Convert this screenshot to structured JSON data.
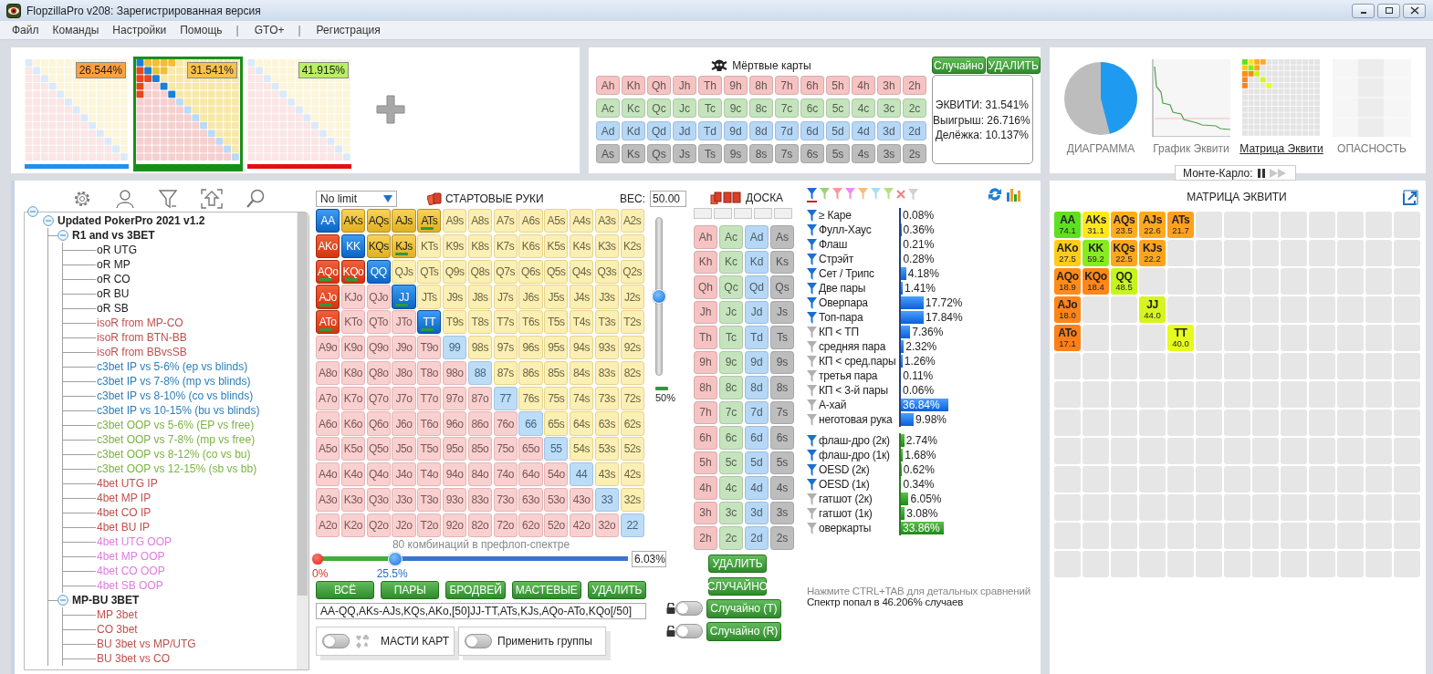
{
  "window": {
    "title": "FlopzillaPro v208: Зарегистрированная версия"
  },
  "menu": [
    {
      "label": "Файл",
      "kind": "item"
    },
    {
      "label": "Команды",
      "kind": "item"
    },
    {
      "label": "Настройки",
      "kind": "item"
    },
    {
      "label": "Помощь",
      "kind": "item"
    },
    {
      "label": "|",
      "kind": "separator"
    },
    {
      "label": "GTO+",
      "kind": "item"
    },
    {
      "label": "|",
      "kind": "separator"
    },
    {
      "label": "Регистрация",
      "kind": "item"
    }
  ],
  "ranges": [
    {
      "selected": false,
      "color": "#1e90ee",
      "equity": {
        "text": "26.544%",
        "color": "#ffa040"
      }
    },
    {
      "selected": true,
      "color": "#139013",
      "equity": {
        "text": "31.541%",
        "color": "#f8c24a"
      }
    },
    {
      "selected": false,
      "color": "#e01010",
      "equity": {
        "text": "41.915%",
        "color": "#b8f064"
      }
    }
  ],
  "dead_cards": {
    "title": "Мёртвые карты",
    "buttons": [
      "Случайно",
      "УДАЛИТЬ"
    ],
    "rows": [
      {
        "color": "#f6c3c3",
        "cards": [
          "Ah",
          "Kh",
          "Qh",
          "Jh",
          "Th",
          "9h",
          "8h",
          "7h",
          "6h",
          "5h",
          "4h",
          "3h",
          "2h"
        ]
      },
      {
        "color": "#c5e4bd",
        "cards": [
          "Ac",
          "Kc",
          "Qc",
          "Jc",
          "Tc",
          "9c",
          "8c",
          "7c",
          "6c",
          "5c",
          "4c",
          "3c",
          "2c"
        ]
      },
      {
        "color": "#b6d8f6",
        "cards": [
          "Ad",
          "Kd",
          "Qd",
          "Jd",
          "Td",
          "9d",
          "8d",
          "7d",
          "6d",
          "5d",
          "4d",
          "3d",
          "2d"
        ]
      },
      {
        "color": "#bdbdbd",
        "cards": [
          "As",
          "Ks",
          "Qs",
          "Js",
          "Ts",
          "9s",
          "8s",
          "7s",
          "6s",
          "5s",
          "4s",
          "3s",
          "2s"
        ]
      }
    ]
  },
  "equity_summary": [
    "ЭКВИТИ: 31.541%",
    "Выигрыш: 26.716%",
    "Делёжка: 10.137%"
  ],
  "chart_tabs": [
    {
      "label": "ДИАГРАММА",
      "kind": "pie",
      "selected": false
    },
    {
      "label": "График Эквити",
      "kind": "line",
      "selected": false
    },
    {
      "label": "Матрица Эквити",
      "kind": "matrix",
      "selected": true
    },
    {
      "label": "ОПАСНОСТЬ",
      "kind": "danger",
      "selected": false
    }
  ],
  "monte_carlo": {
    "label": "Монте-Карло:"
  },
  "tree": {
    "expanded": true,
    "children": [
      {
        "label": "Updated PokerPro 2021 v1.2",
        "expanded": true,
        "children": [
          {
            "label": "R1 and vs 3BET",
            "expanded": true,
            "children": [
              {
                "label": "oR UTG",
                "color": "#1a1a1a"
              },
              {
                "label": "oR MP",
                "color": "#1a1a1a"
              },
              {
                "label": "oR CO",
                "color": "#1a1a1a"
              },
              {
                "label": "oR BU",
                "color": "#1a1a1a"
              },
              {
                "label": "oR SB",
                "color": "#1a1a1a"
              },
              {
                "label": "isoR from MP-CO",
                "color": "#c0504d"
              },
              {
                "label": "isoR from BTN-BB",
                "color": "#c0504d"
              },
              {
                "label": "isoR from BBvsSB",
                "color": "#c0504d"
              },
              {
                "label": "c3bet IP vs 5-6% (ep vs blinds)",
                "color": "#2e7fb8"
              },
              {
                "label": "c3bet IP vs 7-8% (mp vs blinds)",
                "color": "#2e7fb8"
              },
              {
                "label": "c3bet IP vs 8-10% (co vs blinds)",
                "color": "#2e7fb8"
              },
              {
                "label": "c3bet IP vs 10-15% (bu vs blinds)",
                "color": "#2e7fb8"
              },
              {
                "label": "c3bet OOP vs 5-6% (EP vs free)",
                "color": "#7cb342"
              },
              {
                "label": "c3bet OOP vs 7-8% (mp vs free)",
                "color": "#7cb342"
              },
              {
                "label": "c3bet OOP vs 8-12% (co vs bu)",
                "color": "#7cb342"
              },
              {
                "label": "c3bet OOP vs 12-15% (sb vs bb)",
                "color": "#7cb342"
              },
              {
                "label": "4bet UTG IP",
                "color": "#c0504d"
              },
              {
                "label": "4bet MP IP",
                "color": "#c0504d"
              },
              {
                "label": "4bet CO IP",
                "color": "#c0504d"
              },
              {
                "label": "4bet BU IP",
                "color": "#c0504d"
              },
              {
                "label": "4bet UTG OOP",
                "color": "#e07be0"
              },
              {
                "label": "4bet MP OOP",
                "color": "#e07be0"
              },
              {
                "label": "4bet CO OOP",
                "color": "#e07be0"
              },
              {
                "label": "4bet SB OOP",
                "color": "#e07be0"
              }
            ]
          },
          {
            "label": "MP-BU 3BET",
            "expanded": true,
            "children": [
              {
                "label": "MP 3bet",
                "color": "#c0504d"
              },
              {
                "label": "CO 3bet",
                "color": "#c0504d"
              },
              {
                "label": "BU 3bet vs MP/UTG",
                "color": "#c0504d"
              },
              {
                "label": "BU 3bet vs CO",
                "color": "#c0504d"
              }
            ]
          }
        ]
      }
    ]
  },
  "hands_panel": {
    "game": "No limit",
    "title": "СТАРТОВЫЕ РУКИ",
    "weight_label": "ВЕС:",
    "weight_value": "50.00",
    "combos": "80 комбинаций в префлоп-спектре",
    "min_label": "0%",
    "slider_label": "25.5%",
    "percent": "6.03%",
    "buttons": [
      "ВСЁ",
      "ПАРЫ",
      "БРОДВЕЙ",
      "МАСТЕВЫЕ",
      "УДАЛИТЬ"
    ],
    "range_text": "AA-QQ,AKs-AJs,KQs,AKo,[50]JJ-TT,ATs,KJs,AQo-ATo,KQo[/50]",
    "toggles": [
      {
        "label": "МАСТИ КАРТ",
        "on": false,
        "kind": "suits"
      },
      {
        "label": "Применить группы",
        "on": false,
        "kind": "plain"
      }
    ]
  },
  "weight": {
    "level": 0.5,
    "reading": "50%"
  },
  "combo_slider": {
    "level": 0.255
  },
  "hands": [
    [
      {
        "label": "AA",
        "selected": true,
        "partial": false
      },
      {
        "label": "AKs",
        "selected": true,
        "partial": false
      },
      {
        "label": "AQs",
        "selected": true,
        "partial": false
      },
      {
        "label": "AJs",
        "selected": true,
        "partial": false
      },
      {
        "label": "ATs",
        "selected": true,
        "partial": true
      },
      {
        "label": "A9s",
        "selected": false,
        "partial": false
      },
      {
        "label": "A8s",
        "selected": false,
        "partial": false
      },
      {
        "label": "A7s",
        "selected": false,
        "partial": false
      },
      {
        "label": "A6s",
        "selected": false,
        "partial": false
      },
      {
        "label": "A5s",
        "selected": false,
        "partial": false
      },
      {
        "label": "A4s",
        "selected": false,
        "partial": false
      },
      {
        "label": "A3s",
        "selected": false,
        "partial": false
      },
      {
        "label": "A2s",
        "selected": false,
        "partial": false
      }
    ],
    [
      {
        "label": "AKo",
        "selected": true,
        "partial": false
      },
      {
        "label": "KK",
        "selected": true,
        "partial": false
      },
      {
        "label": "KQs",
        "selected": true,
        "partial": false
      },
      {
        "label": "KJs",
        "selected": true,
        "partial": true
      },
      {
        "label": "KTs",
        "selected": false,
        "partial": false
      },
      {
        "label": "K9s",
        "selected": false,
        "partial": false
      },
      {
        "label": "K8s",
        "selected": false,
        "partial": false
      },
      {
        "label": "K7s",
        "selected": false,
        "partial": false
      },
      {
        "label": "K6s",
        "selected": false,
        "partial": false
      },
      {
        "label": "K5s",
        "selected": false,
        "partial": false
      },
      {
        "label": "K4s",
        "selected": false,
        "partial": false
      },
      {
        "label": "K3s",
        "selected": false,
        "partial": false
      },
      {
        "label": "K2s",
        "selected": false,
        "partial": false
      }
    ],
    [
      {
        "label": "AQo",
        "selected": true,
        "partial": true
      },
      {
        "label": "KQo",
        "selected": true,
        "partial": true
      },
      {
        "label": "QQ",
        "selected": true,
        "partial": false
      },
      {
        "label": "QJs",
        "selected": false,
        "partial": false
      },
      {
        "label": "QTs",
        "selected": false,
        "partial": false
      },
      {
        "label": "Q9s",
        "selected": false,
        "partial": false
      },
      {
        "label": "Q8s",
        "selected": false,
        "partial": false
      },
      {
        "label": "Q7s",
        "selected": false,
        "partial": false
      },
      {
        "label": "Q6s",
        "selected": false,
        "partial": false
      },
      {
        "label": "Q5s",
        "selected": false,
        "partial": false
      },
      {
        "label": "Q4s",
        "selected": false,
        "partial": false
      },
      {
        "label": "Q3s",
        "selected": false,
        "partial": false
      },
      {
        "label": "Q2s",
        "selected": false,
        "partial": false
      }
    ],
    [
      {
        "label": "AJo",
        "selected": true,
        "partial": true
      },
      {
        "label": "KJo",
        "selected": false,
        "partial": false
      },
      {
        "label": "QJo",
        "selected": false,
        "partial": false
      },
      {
        "label": "JJ",
        "selected": true,
        "partial": true
      },
      {
        "label": "JTs",
        "selected": false,
        "partial": false
      },
      {
        "label": "J9s",
        "selected": false,
        "partial": false
      },
      {
        "label": "J8s",
        "selected": false,
        "partial": false
      },
      {
        "label": "J7s",
        "selected": false,
        "partial": false
      },
      {
        "label": "J6s",
        "selected": false,
        "partial": false
      },
      {
        "label": "J5s",
        "selected": false,
        "partial": false
      },
      {
        "label": "J4s",
        "selected": false,
        "partial": false
      },
      {
        "label": "J3s",
        "selected": false,
        "partial": false
      },
      {
        "label": "J2s",
        "selected": false,
        "partial": false
      }
    ],
    [
      {
        "label": "ATo",
        "selected": true,
        "partial": true
      },
      {
        "label": "KTo",
        "selected": false,
        "partial": false
      },
      {
        "label": "QTo",
        "selected": false,
        "partial": false
      },
      {
        "label": "JTo",
        "selected": false,
        "partial": false
      },
      {
        "label": "TT",
        "selected": true,
        "partial": true
      },
      {
        "label": "T9s",
        "selected": false,
        "partial": false
      },
      {
        "label": "T8s",
        "selected": false,
        "partial": false
      },
      {
        "label": "T7s",
        "selected": false,
        "partial": false
      },
      {
        "label": "T6s",
        "selected": false,
        "partial": false
      },
      {
        "label": "T5s",
        "selected": false,
        "partial": false
      },
      {
        "label": "T4s",
        "selected": false,
        "partial": false
      },
      {
        "label": "T3s",
        "selected": false,
        "partial": false
      },
      {
        "label": "T2s",
        "selected": false,
        "partial": false
      }
    ],
    [
      {
        "label": "A9o",
        "selected": false,
        "partial": false
      },
      {
        "label": "K9o",
        "selected": false,
        "partial": false
      },
      {
        "label": "Q9o",
        "selected": false,
        "partial": false
      },
      {
        "label": "J9o",
        "selected": false,
        "partial": false
      },
      {
        "label": "T9o",
        "selected": false,
        "partial": false
      },
      {
        "label": "99",
        "selected": false,
        "partial": false
      },
      {
        "label": "98s",
        "selected": false,
        "partial": false
      },
      {
        "label": "97s",
        "selected": false,
        "partial": false
      },
      {
        "label": "96s",
        "selected": false,
        "partial": false
      },
      {
        "label": "95s",
        "selected": false,
        "partial": false
      },
      {
        "label": "94s",
        "selected": false,
        "partial": false
      },
      {
        "label": "93s",
        "selected": false,
        "partial": false
      },
      {
        "label": "92s",
        "selected": false,
        "partial": false
      }
    ],
    [
      {
        "label": "A8o",
        "selected": false,
        "partial": false
      },
      {
        "label": "K8o",
        "selected": false,
        "partial": false
      },
      {
        "label": "Q8o",
        "selected": false,
        "partial": false
      },
      {
        "label": "J8o",
        "selected": false,
        "partial": false
      },
      {
        "label": "T8o",
        "selected": false,
        "partial": false
      },
      {
        "label": "98o",
        "selected": false,
        "partial": false
      },
      {
        "label": "88",
        "selected": false,
        "partial": false
      },
      {
        "label": "87s",
        "selected": false,
        "partial": false
      },
      {
        "label": "86s",
        "selected": false,
        "partial": false
      },
      {
        "label": "85s",
        "selected": false,
        "partial": false
      },
      {
        "label": "84s",
        "selected": false,
        "partial": false
      },
      {
        "label": "83s",
        "selected": false,
        "partial": false
      },
      {
        "label": "82s",
        "selected": false,
        "partial": false
      }
    ],
    [
      {
        "label": "A7o",
        "selected": false,
        "partial": false
      },
      {
        "label": "K7o",
        "selected": false,
        "partial": false
      },
      {
        "label": "Q7o",
        "selected": false,
        "partial": false
      },
      {
        "label": "J7o",
        "selected": false,
        "partial": false
      },
      {
        "label": "T7o",
        "selected": false,
        "partial": false
      },
      {
        "label": "97o",
        "selected": false,
        "partial": false
      },
      {
        "label": "87o",
        "selected": false,
        "partial": false
      },
      {
        "label": "77",
        "selected": false,
        "partial": false
      },
      {
        "label": "76s",
        "selected": false,
        "partial": false
      },
      {
        "label": "75s",
        "selected": false,
        "partial": false
      },
      {
        "label": "74s",
        "selected": false,
        "partial": false
      },
      {
        "label": "73s",
        "selected": false,
        "partial": false
      },
      {
        "label": "72s",
        "selected": false,
        "partial": false
      }
    ],
    [
      {
        "label": "A6o",
        "selected": false,
        "partial": false
      },
      {
        "label": "K6o",
        "selected": false,
        "partial": false
      },
      {
        "label": "Q6o",
        "selected": false,
        "partial": false
      },
      {
        "label": "J6o",
        "selected": false,
        "partial": false
      },
      {
        "label": "T6o",
        "selected": false,
        "partial": false
      },
      {
        "label": "96o",
        "selected": false,
        "partial": false
      },
      {
        "label": "86o",
        "selected": false,
        "partial": false
      },
      {
        "label": "76o",
        "selected": false,
        "partial": false
      },
      {
        "label": "66",
        "selected": false,
        "partial": false
      },
      {
        "label": "65s",
        "selected": false,
        "partial": false
      },
      {
        "label": "64s",
        "selected": false,
        "partial": false
      },
      {
        "label": "63s",
        "selected": false,
        "partial": false
      },
      {
        "label": "62s",
        "selected": false,
        "partial": false
      }
    ],
    [
      {
        "label": "A5o",
        "selected": false,
        "partial": false
      },
      {
        "label": "K5o",
        "selected": false,
        "partial": false
      },
      {
        "label": "Q5o",
        "selected": false,
        "partial": false
      },
      {
        "label": "J5o",
        "selected": false,
        "partial": false
      },
      {
        "label": "T5o",
        "selected": false,
        "partial": false
      },
      {
        "label": "95o",
        "selected": false,
        "partial": false
      },
      {
        "label": "85o",
        "selected": false,
        "partial": false
      },
      {
        "label": "75o",
        "selected": false,
        "partial": false
      },
      {
        "label": "65o",
        "selected": false,
        "partial": false
      },
      {
        "label": "55",
        "selected": false,
        "partial": false
      },
      {
        "label": "54s",
        "selected": false,
        "partial": false
      },
      {
        "label": "53s",
        "selected": false,
        "partial": false
      },
      {
        "label": "52s",
        "selected": false,
        "partial": false
      }
    ],
    [
      {
        "label": "A4o",
        "selected": false,
        "partial": false
      },
      {
        "label": "K4o",
        "selected": false,
        "partial": false
      },
      {
        "label": "Q4o",
        "selected": false,
        "partial": false
      },
      {
        "label": "J4o",
        "selected": false,
        "partial": false
      },
      {
        "label": "T4o",
        "selected": false,
        "partial": false
      },
      {
        "label": "94o",
        "selected": false,
        "partial": false
      },
      {
        "label": "84o",
        "selected": false,
        "partial": false
      },
      {
        "label": "74o",
        "selected": false,
        "partial": false
      },
      {
        "label": "64o",
        "selected": false,
        "partial": false
      },
      {
        "label": "54o",
        "selected": false,
        "partial": false
      },
      {
        "label": "44",
        "selected": false,
        "partial": false
      },
      {
        "label": "43s",
        "selected": false,
        "partial": false
      },
      {
        "label": "42s",
        "selected": false,
        "partial": false
      }
    ],
    [
      {
        "label": "A3o",
        "selected": false,
        "partial": false
      },
      {
        "label": "K3o",
        "selected": false,
        "partial": false
      },
      {
        "label": "Q3o",
        "selected": false,
        "partial": false
      },
      {
        "label": "J3o",
        "selected": false,
        "partial": false
      },
      {
        "label": "T3o",
        "selected": false,
        "partial": false
      },
      {
        "label": "93o",
        "selected": false,
        "partial": false
      },
      {
        "label": "83o",
        "selected": false,
        "partial": false
      },
      {
        "label": "73o",
        "selected": false,
        "partial": false
      },
      {
        "label": "63o",
        "selected": false,
        "partial": false
      },
      {
        "label": "53o",
        "selected": false,
        "partial": false
      },
      {
        "label": "43o",
        "selected": false,
        "partial": false
      },
      {
        "label": "33",
        "selected": false,
        "partial": false
      },
      {
        "label": "32s",
        "selected": false,
        "partial": false
      }
    ],
    [
      {
        "label": "A2o",
        "selected": false,
        "partial": false
      },
      {
        "label": "K2o",
        "selected": false,
        "partial": false
      },
      {
        "label": "Q2o",
        "selected": false,
        "partial": false
      },
      {
        "label": "J2o",
        "selected": false,
        "partial": false
      },
      {
        "label": "T2o",
        "selected": false,
        "partial": false
      },
      {
        "label": "92o",
        "selected": false,
        "partial": false
      },
      {
        "label": "82o",
        "selected": false,
        "partial": false
      },
      {
        "label": "72o",
        "selected": false,
        "partial": false
      },
      {
        "label": "62o",
        "selected": false,
        "partial": false
      },
      {
        "label": "52o",
        "selected": false,
        "partial": false
      },
      {
        "label": "42o",
        "selected": false,
        "partial": false
      },
      {
        "label": "32o",
        "selected": false,
        "partial": false
      },
      {
        "label": "22",
        "selected": false,
        "partial": false
      }
    ]
  ],
  "board": {
    "title": "ДОСКА",
    "columns": [
      {
        "color": "#f6c3c3",
        "cards": [
          "Ah",
          "Kh",
          "Qh",
          "Jh",
          "Th",
          "9h",
          "8h",
          "7h",
          "6h",
          "5h",
          "4h",
          "3h",
          "2h"
        ]
      },
      {
        "color": "#c5e4bd",
        "cards": [
          "Ac",
          "Kc",
          "Qc",
          "Jc",
          "Tc",
          "9c",
          "8c",
          "7c",
          "6c",
          "5c",
          "4c",
          "3c",
          "2c"
        ]
      },
      {
        "color": "#b6d8f6",
        "cards": [
          "Ad",
          "Kd",
          "Qd",
          "Jd",
          "Td",
          "9d",
          "8d",
          "7d",
          "6d",
          "5d",
          "4d",
          "3d",
          "2d"
        ]
      },
      {
        "color": "#bdbdbd",
        "cards": [
          "As",
          "Ks",
          "Qs",
          "Js",
          "Ts",
          "9s",
          "8s",
          "7s",
          "6s",
          "5s",
          "4s",
          "3s",
          "2s"
        ]
      }
    ],
    "buttons": [
      "УДАЛИТЬ",
      "СЛУЧАЙНО"
    ],
    "random": [
      {
        "label": "Случайно (T)",
        "on": false
      },
      {
        "label": "Случайно (R)",
        "on": false
      }
    ]
  },
  "stats": {
    "filters": [
      {
        "color": "#1c6fd2",
        "selected": true
      },
      {
        "color": "#9ad27a",
        "selected": false
      },
      {
        "color": "#f29a9a",
        "selected": false
      },
      {
        "color": "#ee8cee",
        "selected": false
      },
      {
        "color": "#f0c080",
        "selected": false
      },
      {
        "color": "#a6e0f2",
        "selected": false
      },
      {
        "color": "#b4e07c",
        "selected": false
      }
    ],
    "groups": [
      {
        "kind": "made",
        "items": [
          {
            "label": "≥ Каре",
            "active": true,
            "value": "0.08%",
            "level": 0.0008
          },
          {
            "label": "Фулл-Хаус",
            "active": true,
            "value": "0.36%",
            "level": 0.0036
          },
          {
            "label": "Флаш",
            "active": true,
            "value": "0.21%",
            "level": 0.0021
          },
          {
            "label": "Стрэйт",
            "active": true,
            "value": "0.28%",
            "level": 0.0028
          },
          {
            "label": "Сет / Трипс",
            "active": true,
            "value": "4.18%",
            "level": 0.0418
          },
          {
            "label": "Две пары",
            "active": true,
            "value": "1.41%",
            "level": 0.0141
          },
          {
            "label": "Оверпара",
            "active": true,
            "value": "17.72%",
            "level": 0.1772
          },
          {
            "label": "Топ-пара",
            "active": true,
            "value": "17.84%",
            "level": 0.1784
          },
          {
            "label": "КП < ТП",
            "active": false,
            "value": "7.36%",
            "level": 0.0736
          },
          {
            "label": "средняя пара",
            "active": false,
            "value": "2.32%",
            "level": 0.0232
          },
          {
            "label": "КП < сред.пары",
            "active": false,
            "value": "1.26%",
            "level": 0.0126
          },
          {
            "label": "третья пара",
            "active": false,
            "value": "0.11%",
            "level": 0.0011
          },
          {
            "label": "КП < 3-й пары",
            "active": false,
            "value": "0.06%",
            "level": 0.0006
          },
          {
            "label": "А-хай",
            "active": false,
            "value": "36.84%",
            "level": 0.3684
          },
          {
            "label": "неготовая рука",
            "active": false,
            "value": "9.98%",
            "level": 0.0998
          }
        ]
      },
      {
        "kind": "draw",
        "items": [
          {
            "label": "флаш-дро (2к)",
            "active": true,
            "value": "2.74%",
            "level": 0.0274
          },
          {
            "label": "флаш-дро (1к)",
            "active": true,
            "value": "1.68%",
            "level": 0.0168
          },
          {
            "label": "OESD (2к)",
            "active": true,
            "value": "0.62%",
            "level": 0.0062
          },
          {
            "label": "OESD (1к)",
            "active": true,
            "value": "0.34%",
            "level": 0.0034
          },
          {
            "label": "гатшот (2к)",
            "active": false,
            "value": "6.05%",
            "level": 0.0605
          },
          {
            "label": "гатшот (1к)",
            "active": false,
            "value": "3.08%",
            "level": 0.0308
          },
          {
            "label": "оверкарты",
            "active": false,
            "value": "33.86%",
            "level": 0.3386
          }
        ]
      }
    ],
    "hints": [
      {
        "text": "Нажмите CTRL+TAB для детальных сравнений",
        "kind": "muted"
      },
      {
        "text": "Спектр попал в 46.206% случаев",
        "kind": "normal"
      }
    ]
  },
  "equity_matrix": {
    "title": "МАТРИЦА ЭКВИТИ",
    "rows": [
      [
        {
          "label": "AA",
          "value": "74.1",
          "color": "#5fe01e"
        },
        {
          "label": "AKs",
          "value": "31.1",
          "color": "#ffe81a"
        },
        {
          "label": "AQs",
          "value": "23.5",
          "color": "#ffad1f"
        },
        {
          "label": "AJs",
          "value": "22.6",
          "color": "#ffa91f"
        },
        {
          "label": "ATs",
          "value": "21.7",
          "color": "#ffa01f"
        },
        null,
        null,
        null,
        null,
        null,
        null,
        null,
        null
      ],
      [
        {
          "label": "AKo",
          "value": "27.5",
          "color": "#ffcc1a"
        },
        {
          "label": "KK",
          "value": "59.2",
          "color": "#86ec1e"
        },
        {
          "label": "KQs",
          "value": "22.5",
          "color": "#ffa61f"
        },
        {
          "label": "KJs",
          "value": "22.2",
          "color": "#ffa41f"
        },
        null,
        null,
        null,
        null,
        null,
        null,
        null,
        null,
        null
      ],
      [
        {
          "label": "AQo",
          "value": "18.9",
          "color": "#ff8c1a"
        },
        {
          "label": "KQo",
          "value": "18.4",
          "color": "#ff861a"
        },
        {
          "label": "QQ",
          "value": "48.5",
          "color": "#c6f51e"
        },
        null,
        null,
        null,
        null,
        null,
        null,
        null,
        null,
        null,
        null
      ],
      [
        {
          "label": "AJo",
          "value": "18.0",
          "color": "#ff841a"
        },
        null,
        null,
        {
          "label": "JJ",
          "value": "44.0",
          "color": "#d6f51e"
        },
        null,
        null,
        null,
        null,
        null,
        null,
        null,
        null,
        null
      ],
      [
        {
          "label": "ATo",
          "value": "17.1",
          "color": "#ff801a"
        },
        null,
        null,
        null,
        {
          "label": "TT",
          "value": "40.0",
          "color": "#e6fb1e"
        },
        null,
        null,
        null,
        null,
        null,
        null,
        null,
        null
      ],
      [
        null,
        null,
        null,
        null,
        null,
        null,
        null,
        null,
        null,
        null,
        null,
        null,
        null
      ],
      [
        null,
        null,
        null,
        null,
        null,
        null,
        null,
        null,
        null,
        null,
        null,
        null,
        null
      ],
      [
        null,
        null,
        null,
        null,
        null,
        null,
        null,
        null,
        null,
        null,
        null,
        null,
        null
      ],
      [
        null,
        null,
        null,
        null,
        null,
        null,
        null,
        null,
        null,
        null,
        null,
        null,
        null
      ],
      [
        null,
        null,
        null,
        null,
        null,
        null,
        null,
        null,
        null,
        null,
        null,
        null,
        null
      ],
      [
        null,
        null,
        null,
        null,
        null,
        null,
        null,
        null,
        null,
        null,
        null,
        null,
        null
      ],
      [
        null,
        null,
        null,
        null,
        null,
        null,
        null,
        null,
        null,
        null,
        null,
        null,
        null
      ],
      [
        null,
        null,
        null,
        null,
        null,
        null,
        null,
        null,
        null,
        null,
        null,
        null,
        null
      ]
    ]
  }
}
